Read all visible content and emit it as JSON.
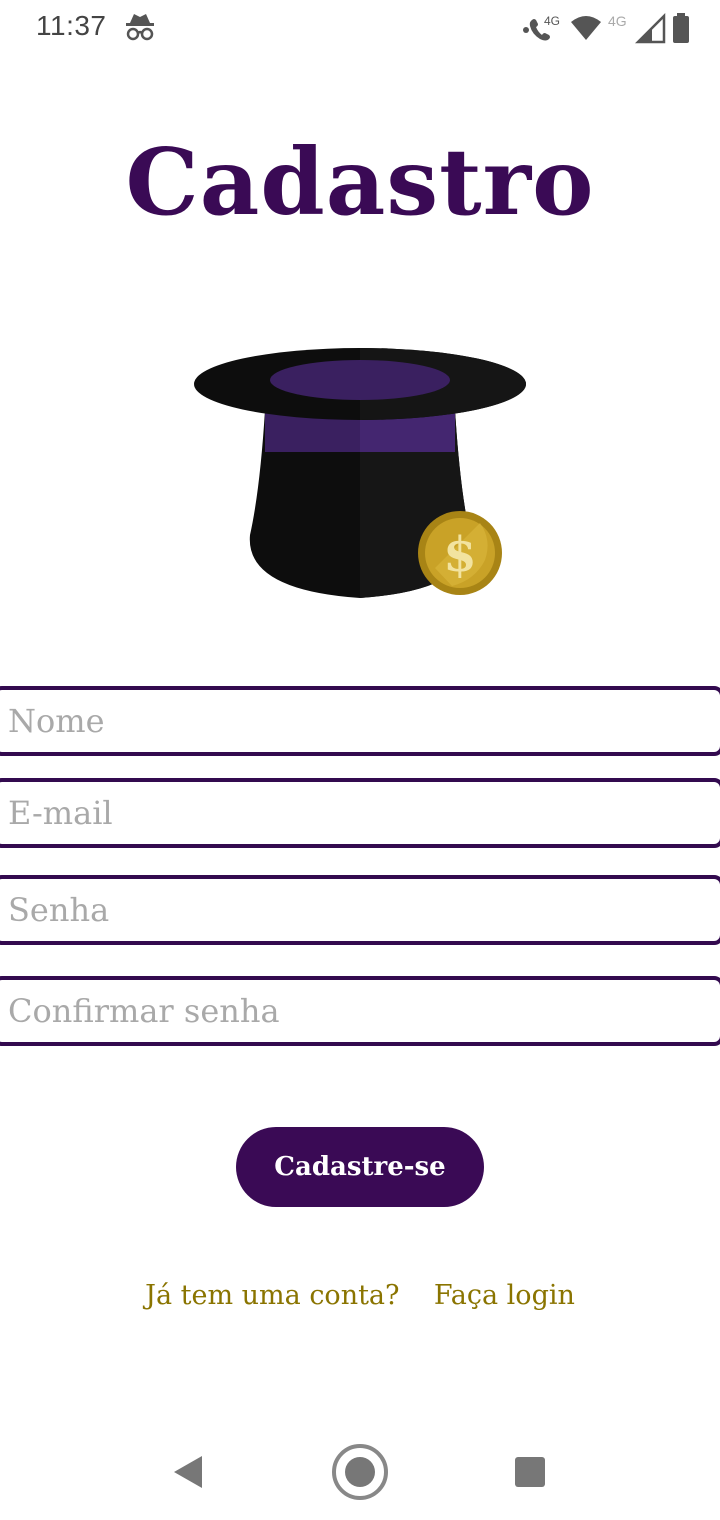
{
  "status_bar": {
    "time": "11:37",
    "icons": [
      "incognito-icon",
      "call-4g-icon",
      "wifi-icon",
      "signal-4g-icon",
      "battery-icon"
    ],
    "network_label_1": "4G",
    "network_label_2": "4G"
  },
  "page": {
    "title": "Cadastro"
  },
  "logo": {
    "icon": "top-hat-coin-logo",
    "colors": {
      "hat": "#0d0d0d",
      "band": "#3a2060",
      "coin": "#c9a227"
    },
    "coin_symbol": "$"
  },
  "form": {
    "name_placeholder": "Nome",
    "email_placeholder": "E-mail",
    "password_placeholder": "Senha",
    "confirm_password_placeholder": "Confirmar senha",
    "submit_label": "Cadastre-se"
  },
  "footer": {
    "question": "Já tem uma conta?",
    "login_link": "Faça login"
  },
  "colors": {
    "primary": "#3a0a55",
    "link": "#8a7400",
    "placeholder": "#a9a9a9"
  },
  "nav_bar": {
    "icons": [
      "back-icon",
      "home-icon",
      "recents-icon"
    ]
  }
}
